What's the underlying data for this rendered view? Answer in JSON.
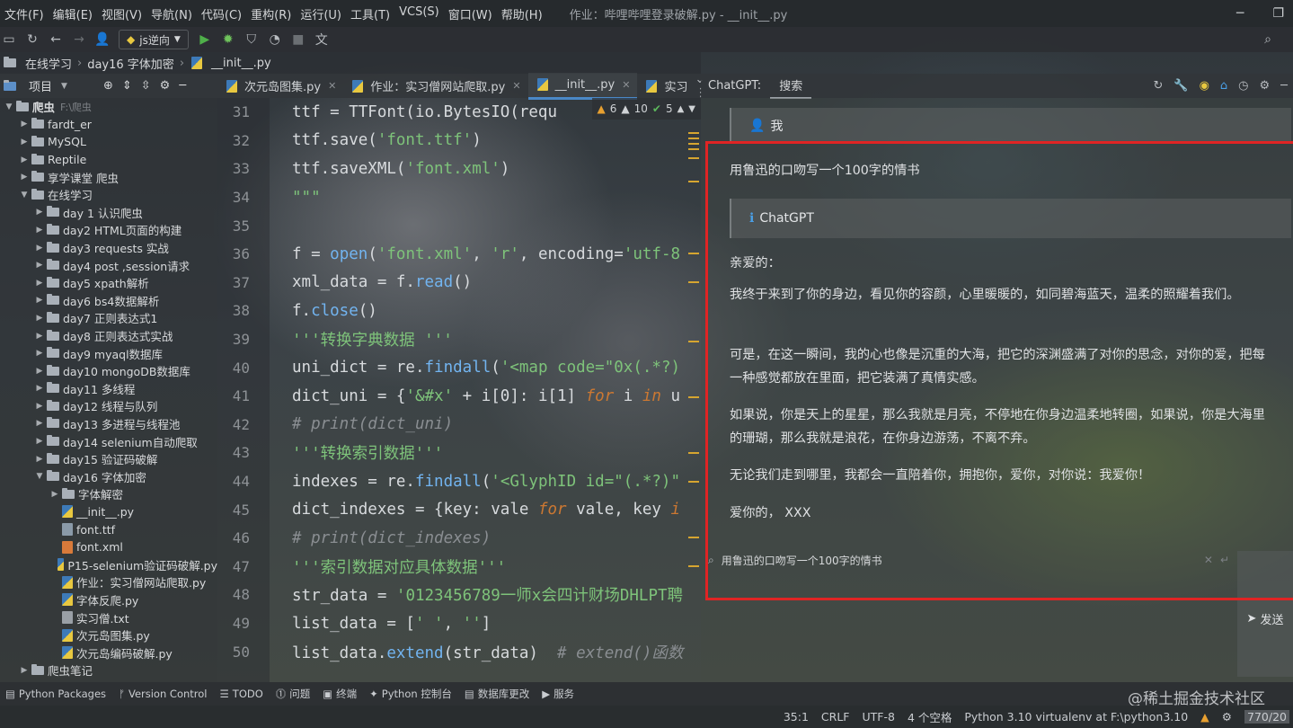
{
  "menubar": {
    "items": [
      "文件(F)",
      "编辑(E)",
      "视图(V)",
      "导航(N)",
      "代码(C)",
      "重构(R)",
      "运行(U)",
      "工具(T)",
      "VCS(S)",
      "窗口(W)",
      "帮助(H)"
    ],
    "title": "作业：哔哩哔哩登录破解.py - __init__.py"
  },
  "toolbar": {
    "run_config": "js逆向"
  },
  "breadcrumb": [
    "在线学习",
    "day16 字体加密",
    "__init__.py"
  ],
  "project_panel": {
    "title": "项目",
    "tree": [
      {
        "label": "爬虫",
        "hint": "F:\\爬虫",
        "type": "folder",
        "level": 0,
        "open": true
      },
      {
        "label": "fardt_er",
        "type": "folder",
        "level": 1
      },
      {
        "label": "MySQL",
        "type": "folder",
        "level": 1
      },
      {
        "label": "Reptile",
        "type": "folder",
        "level": 1
      },
      {
        "label": "享学课堂 爬虫",
        "type": "folder",
        "level": 1
      },
      {
        "label": "在线学习",
        "type": "folder",
        "level": 1,
        "open": true
      },
      {
        "label": "day 1 认识爬虫",
        "type": "folder",
        "level": 2
      },
      {
        "label": "day2 HTML页面的构建",
        "type": "folder",
        "level": 2
      },
      {
        "label": "day3 requests 实战",
        "type": "folder",
        "level": 2
      },
      {
        "label": "day4 post ,session请求",
        "type": "folder",
        "level": 2
      },
      {
        "label": "day5 xpath解析",
        "type": "folder",
        "level": 2
      },
      {
        "label": "day6 bs4数据解析",
        "type": "folder",
        "level": 2
      },
      {
        "label": "day7 正则表达式1",
        "type": "folder",
        "level": 2
      },
      {
        "label": "day8 正则表达式实战",
        "type": "folder",
        "level": 2
      },
      {
        "label": "day9 myaql数据库",
        "type": "folder",
        "level": 2
      },
      {
        "label": "day10 mongoDB数据库",
        "type": "folder",
        "level": 2
      },
      {
        "label": "day11 多线程",
        "type": "folder",
        "level": 2
      },
      {
        "label": "day12 线程与队列",
        "type": "folder",
        "level": 2
      },
      {
        "label": "day13 多进程与线程池",
        "type": "folder",
        "level": 2
      },
      {
        "label": "day14 selenium自动爬取",
        "type": "folder",
        "level": 2
      },
      {
        "label": "day15 验证码破解",
        "type": "folder",
        "level": 2
      },
      {
        "label": "day16 字体加密",
        "type": "folder",
        "level": 2,
        "open": true
      },
      {
        "label": "字体解密",
        "type": "folder",
        "level": 3
      },
      {
        "label": "__init__.py",
        "type": "py",
        "level": 3
      },
      {
        "label": "font.ttf",
        "type": "ttf",
        "level": 3
      },
      {
        "label": "font.xml",
        "type": "xml",
        "level": 3
      },
      {
        "label": "P15-selenium验证码破解.py",
        "type": "py",
        "level": 3
      },
      {
        "label": "作业：实习僧网站爬取.py",
        "type": "py",
        "level": 3
      },
      {
        "label": "字体反爬.py",
        "type": "py",
        "level": 3
      },
      {
        "label": "实习僧.txt",
        "type": "txt",
        "level": 3
      },
      {
        "label": "次元岛图集.py",
        "type": "py",
        "level": 3
      },
      {
        "label": "次元岛编码破解.py",
        "type": "py",
        "level": 3
      },
      {
        "label": "爬虫笔记",
        "type": "folder",
        "level": 1
      }
    ]
  },
  "editor_tabs": [
    {
      "label": "次元岛图集.py",
      "active": false
    },
    {
      "label": "作业：实习僧网站爬取.py",
      "active": false
    },
    {
      "label": "__init__.py",
      "active": true
    },
    {
      "label": "实习",
      "active": false
    }
  ],
  "inspections": {
    "warnings": "6",
    "weak_warnings": "10",
    "ok": "5"
  },
  "code_lines": [
    {
      "n": "31",
      "html": "ttf = TTFont(io.BytesIO(requ"
    },
    {
      "n": "32",
      "html": "ttf.save(<s>'font.ttf'</s>)"
    },
    {
      "n": "33",
      "html": "ttf.saveXML(<s>'font.xml'</s>)"
    },
    {
      "n": "34",
      "html": "<s>\"\"\"</s>"
    },
    {
      "n": "35",
      "html": ""
    },
    {
      "n": "36",
      "html": "f = <f>open</f>(<s>'font.xml'</s>, <s>'r'</s>, encoding=<s>'utf-8</s>"
    },
    {
      "n": "37",
      "html": "xml_data = f.<f>read</f>()"
    },
    {
      "n": "38",
      "html": "f.<f>close</f>()"
    },
    {
      "n": "39",
      "html": "<s>'''转换字典数据 '''</s>"
    },
    {
      "n": "40",
      "html": "uni_dict = re.<f>findall</f>(<s>'&lt;map code=\"0x(.*?)</s>"
    },
    {
      "n": "41",
      "html": "dict_uni = {<s>'&amp;#x'</s> + i[0]: i[1] <k>for</k> i <k>in</k> u"
    },
    {
      "n": "42",
      "html": "<c># print(dict_uni)</c>"
    },
    {
      "n": "43",
      "html": "<s>'''转换索引数据'''</s>"
    },
    {
      "n": "44",
      "html": "indexes = re.<f>findall</f>(<s>'&lt;GlyphID id=\"(.*?)\"</s>"
    },
    {
      "n": "45",
      "html": "dict_indexes = {key: vale <k>for</k> vale, key <k>i</k>"
    },
    {
      "n": "46",
      "html": "<c># print(dict_indexes)</c>"
    },
    {
      "n": "47",
      "html": "<s>'''索引数据对应具体数据'''</s>"
    },
    {
      "n": "48",
      "html": "str_data = <s>'0123456789一师x会四计财场DHLPT聘</s>"
    },
    {
      "n": "49",
      "html": "list_data = [<s>' '</s>, <s>''</s>]"
    },
    {
      "n": "50",
      "html": "list_data.<f>extend</f>(str_data)  <c># extend()函数</c>"
    }
  ],
  "chat": {
    "label": "ChatGPT:",
    "tab": "搜索",
    "user_name": "我",
    "user_message": "用鲁迅的口吻写一个100字的情书",
    "bot_name": "ChatGPT",
    "paragraphs": [
      "亲爱的：",
      "我终于来到了你的身边，看见你的容颜，心里暖暖的，如同碧海蓝天，温柔的照耀着我们。",
      "可是，在这一瞬间，我的心也像是沉重的大海，把它的深渊盛满了对你的思念，对你的爱，把每一种感觉都放在里面，把它装满了真情实感。",
      "如果说，你是天上的星星，那么我就是月亮，不停地在你身边温柔地转圈，如果说，你是大海里的珊瑚，那么我就是浪花，在你身边游荡，不离不弃。",
      "无论我们走到哪里，我都会一直陪着你，拥抱你，爱你，对你说：我爱你！",
      "爱你的， XXX"
    ],
    "input_value": "用鲁迅的口吻写一个100字的情书",
    "send_label": "发送"
  },
  "bottom_tools": [
    "Python Packages",
    "Version Control",
    "TODO",
    "问题",
    "终端",
    "Python 控制台",
    "数据库更改",
    "服务"
  ],
  "status": {
    "position": "35:1",
    "line_sep": "CRLF",
    "encoding": "UTF-8",
    "indent": "4 个空格",
    "interpreter": "Python 3.10 virtualenv at F:\\python3.10",
    "memory": "770/20"
  },
  "watermark": "@稀土掘金技术社区"
}
